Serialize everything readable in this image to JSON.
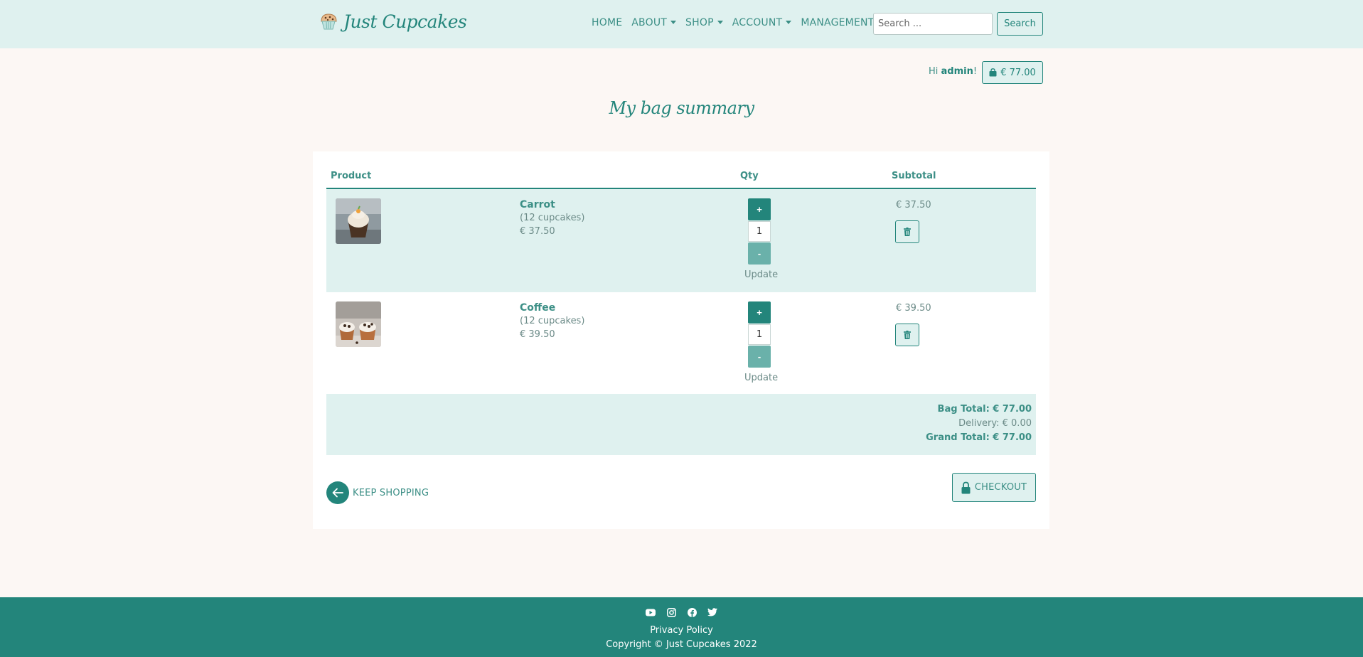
{
  "brand": {
    "name": "Just Cupcakes"
  },
  "nav": {
    "home": "HOME",
    "about": "ABOUT",
    "shop": "SHOP",
    "account": "ACCOUNT",
    "management": "MANAGEMENT"
  },
  "search": {
    "placeholder": "Search ...",
    "button": "Search"
  },
  "user": {
    "greeting_prefix": "Hi ",
    "username": "admin",
    "greeting_suffix": "!"
  },
  "bag_button": {
    "amount": "€ 77.00"
  },
  "page": {
    "title": "My bag summary"
  },
  "table": {
    "headers": {
      "product": "Product",
      "qty": "Qty",
      "subtotal": "Subtotal"
    },
    "rows": [
      {
        "name": "Carrot",
        "pack": "(12 cupcakes)",
        "price": "€ 37.50",
        "qty": "1",
        "plus": "+",
        "minus": "-",
        "update": "Update",
        "subtotal": "€ 37.50"
      },
      {
        "name": "Coffee",
        "pack": "(12 cupcakes)",
        "price": "€ 39.50",
        "qty": "1",
        "plus": "+",
        "minus": "-",
        "update": "Update",
        "subtotal": "€ 39.50"
      }
    ]
  },
  "totals": {
    "bag_total": "Bag Total: € 77.00",
    "delivery": "Delivery: € 0.00",
    "grand_total": "Grand Total: € 77.00"
  },
  "actions": {
    "keep_shopping": "KEEP SHOPPING",
    "checkout": "CHECKOUT"
  },
  "footer": {
    "social_icons": [
      "youtube-icon",
      "instagram-icon",
      "facebook-icon",
      "twitter-icon"
    ],
    "privacy": "Privacy Policy",
    "copyright": "Copyright © Just Cupcakes 2022"
  },
  "colors": {
    "accent": "#23857b",
    "nav_bg": "#dff1ef",
    "page_bg": "#fcf7f4"
  }
}
